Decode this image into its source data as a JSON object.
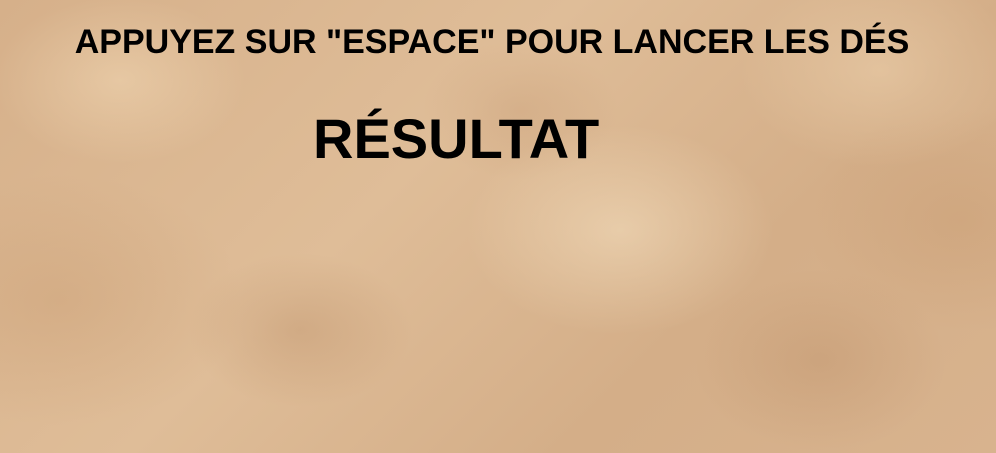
{
  "game": {
    "instruction": "APPUYEZ SUR \"ESPACE\" POUR LANCER LES DÉS",
    "result_title": "RÉSULTAT"
  },
  "theme": {
    "background": "#d9b48e",
    "text_color": "#000000"
  }
}
